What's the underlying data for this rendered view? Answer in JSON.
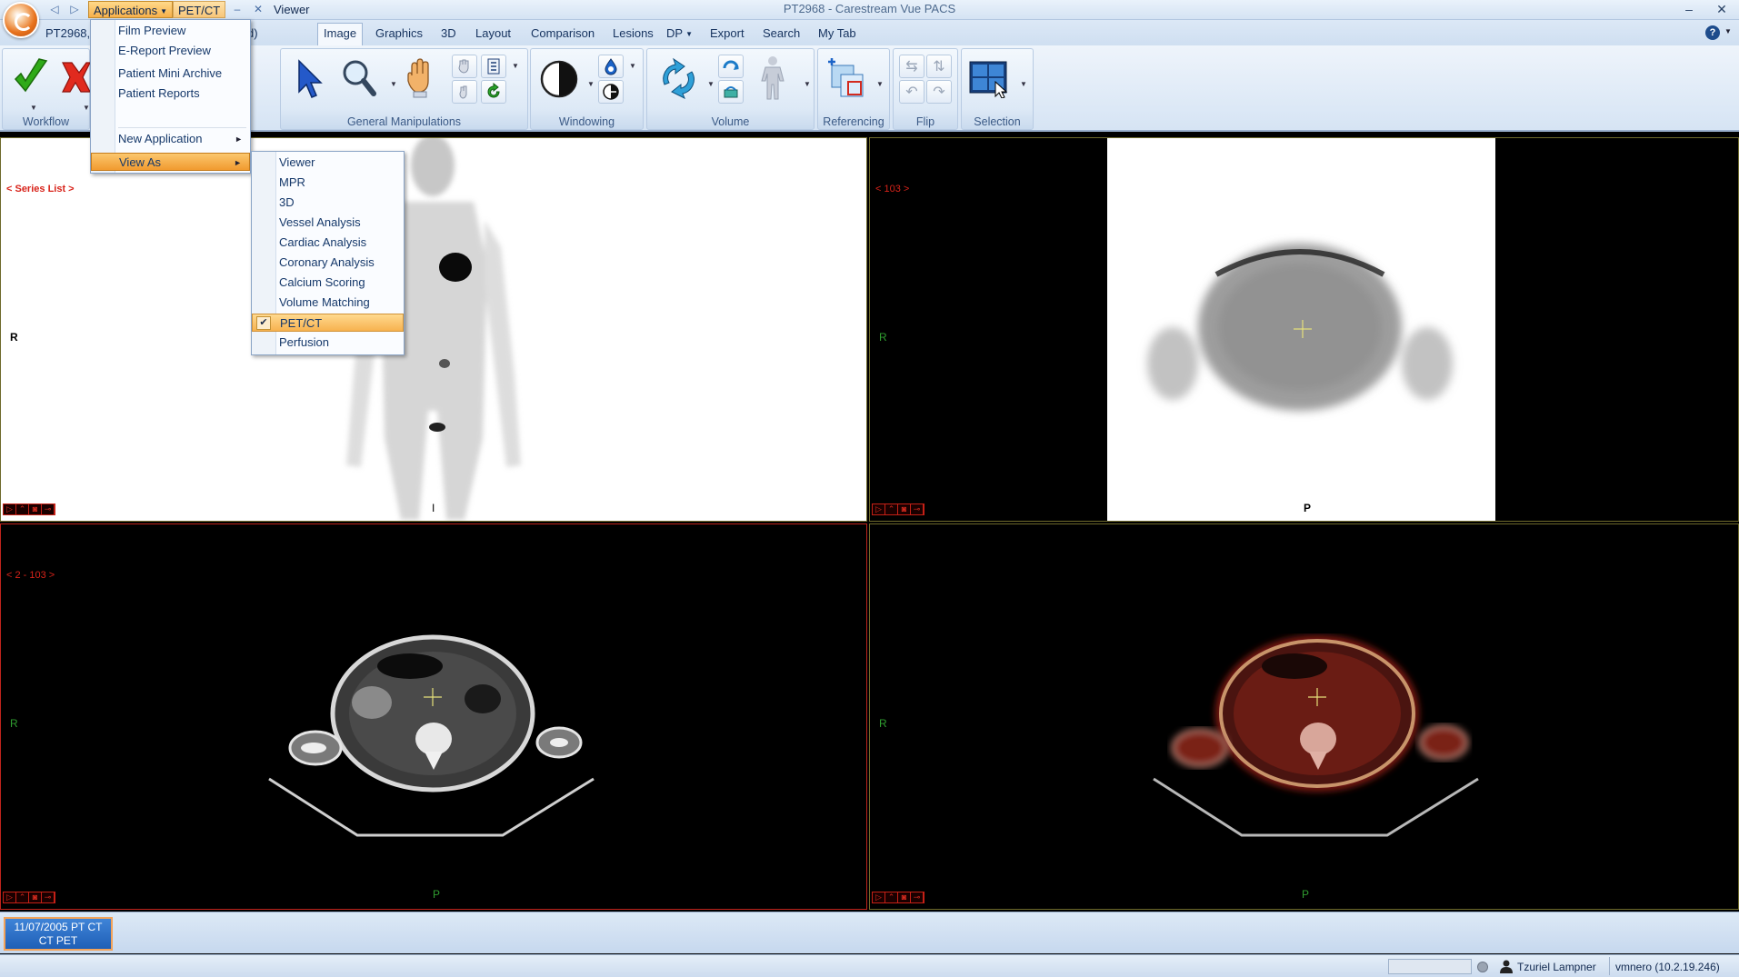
{
  "window": {
    "title": "PT2968 - Carestream Vue PACS",
    "quick_menus": [
      "Applications",
      "PET/CT"
    ],
    "viewer_label": "Viewer",
    "patient_tab": "PT2968,",
    "patient_tab_tail": "d)"
  },
  "tabs": [
    {
      "label": "Image",
      "selected": true
    },
    {
      "label": "Graphics"
    },
    {
      "label": "3D"
    },
    {
      "label": "Layout"
    },
    {
      "label": "Comparison"
    },
    {
      "label": "Lesions"
    },
    {
      "label": "DP",
      "dropdown": true
    },
    {
      "label": "Export"
    },
    {
      "label": "Search"
    },
    {
      "label": "My Tab"
    }
  ],
  "ribbon": {
    "groups": {
      "workflow": "Workflow",
      "general": "General Manipulations",
      "windowing": "Windowing",
      "volume": "Volume",
      "referencing": "Referencing",
      "flip": "Flip",
      "selection": "Selection"
    }
  },
  "applications_menu": {
    "items": [
      "Film Preview",
      "E-Report Preview",
      "Patient Mini Archive",
      "Patient Reports",
      "New Application",
      "View As"
    ]
  },
  "view_as_menu": {
    "items": [
      "Viewer",
      "MPR",
      "3D",
      "Vessel Analysis",
      "Cardiac Analysis",
      "Coronary Analysis",
      "Calcium Scoring",
      "Volume Matching",
      "PET/CT",
      "Perfusion"
    ],
    "checked": "PET/CT"
  },
  "viewports": {
    "top_left": {
      "series_list": "< Series List >",
      "orient_left": "R",
      "orient_bottom": "I"
    },
    "top_right": {
      "slice": "< 103 >",
      "orient_left": "R",
      "orient_bottom": "P"
    },
    "bottom_left": {
      "slice": "< 2 - 103 >",
      "orient_left": "R",
      "orient_bottom": "P"
    },
    "bottom_right": {
      "orient_left": "R",
      "orient_bottom": "P"
    }
  },
  "timeline": {
    "study_line1": "11/07/2005 PT CT",
    "study_line2": "CT PET"
  },
  "status": {
    "user": "Tzuriel Lampner",
    "host": "vmnero (10.2.19.246)"
  },
  "colors": {
    "accent_orange": "#f7b04a",
    "overlay_red": "#d8231a",
    "overlay_green": "#2f9d2f"
  }
}
